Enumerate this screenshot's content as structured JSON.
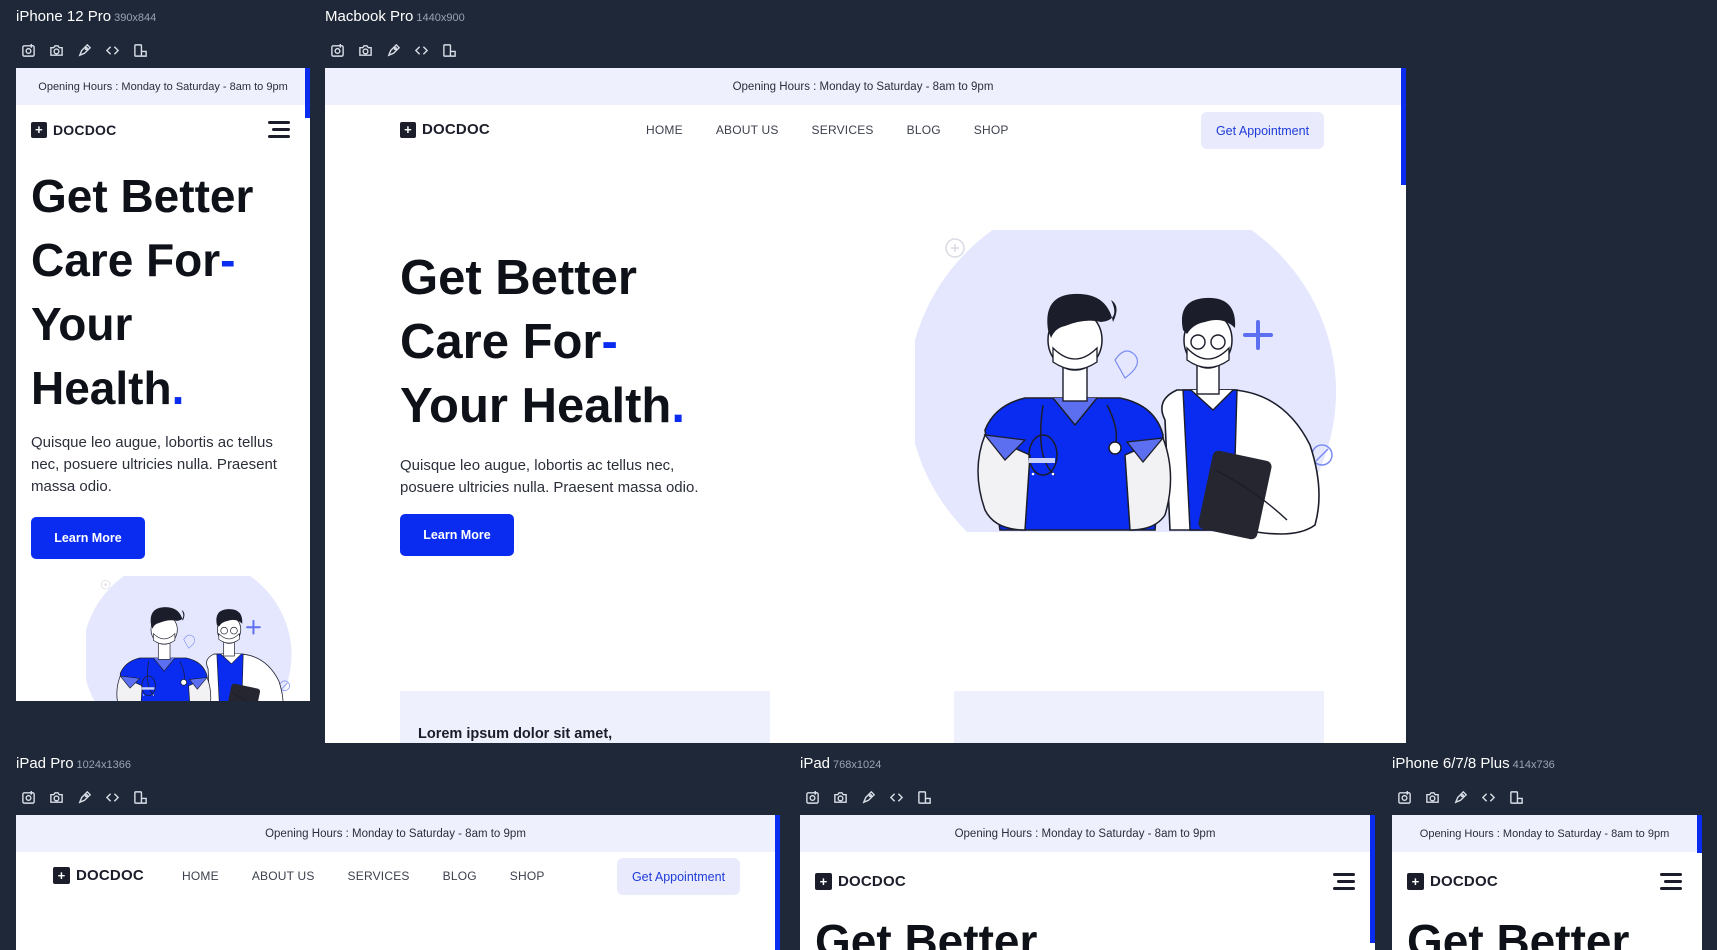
{
  "toolbar_icons": [
    "screenshot-icon",
    "camera-icon",
    "pen-icon",
    "code-icon",
    "rotate-icon"
  ],
  "devices": {
    "iphone12": {
      "name": "iPhone 12 Pro",
      "size": "390x844"
    },
    "macbook": {
      "name": "Macbook Pro",
      "size": "1440x900"
    },
    "ipadpro": {
      "name": "iPad Pro",
      "size": "1024x1366"
    },
    "ipad": {
      "name": "iPad",
      "size": "768x1024"
    },
    "iphone8": {
      "name": "iPhone 6/7/8 Plus",
      "size": "414x736"
    }
  },
  "site": {
    "opening_hours": "Opening Hours : Monday to Saturday - 8am to 9pm",
    "brand": "DOCDOC",
    "brand_symbol": "+",
    "nav": [
      "HOME",
      "ABOUT US",
      "SERVICES",
      "BLOG",
      "SHOP"
    ],
    "cta": "Get Appointment",
    "hero": {
      "line1": "Get Better",
      "line2": "Care For",
      "dash": "-",
      "line3": "Your Health",
      "line3_mobile_a": "Your",
      "line3_mobile_b": "Health",
      "dot": ".",
      "subtitle": "Quisque leo augue, lobortis ac tellus nec, posuere ultricies nulla. Praesent massa odio.",
      "subtitle_line1": "Quisque leo augue, lobortis ac tellus nec,",
      "subtitle_line2": "posuere ultricies nulla. Praesent massa odio.",
      "button": "Learn More"
    },
    "card_title": "Lorem ipsum dolor sit amet,"
  },
  "colors": {
    "accent": "#0a2cf0",
    "background": "#1f2838",
    "panel": "#eef0fd",
    "text": "#0f1119"
  }
}
